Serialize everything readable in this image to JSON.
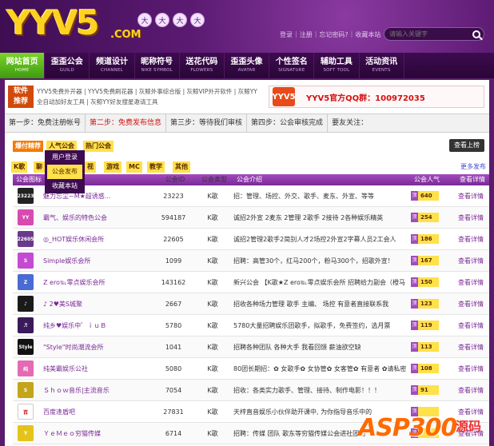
{
  "header": {
    "logo_text": "YYV5",
    "logo_suffix": ".COM",
    "lanterns": [
      "大",
      "大",
      "大",
      "大"
    ],
    "top_links": [
      "登录",
      "注册",
      "忘记密码?",
      "收藏本站"
    ],
    "search_placeholder": "请输入关键字"
  },
  "nav": [
    {
      "cn": "网站首页",
      "en": "HOME"
    },
    {
      "cn": "歪歪公会",
      "en": "GUILD"
    },
    {
      "cn": "频道设计",
      "en": "CHANNEL"
    },
    {
      "cn": "昵称符号",
      "en": "NIKE SYMBOL"
    },
    {
      "cn": "送花代码",
      "en": "FLOWERS"
    },
    {
      "cn": "歪歪头像",
      "en": "AVATAR"
    },
    {
      "cn": "个性签名",
      "en": "SIGNATURE"
    },
    {
      "cn": "辅助工具",
      "en": "SOFT TOOL"
    },
    {
      "cn": "活动资讯",
      "en": "EVENTS"
    }
  ],
  "recommend": {
    "label_line1": "软件",
    "label_line2": "推荐",
    "links_line1": [
      "YYV5免费外开器",
      "YYV5免费刷花器",
      "灰鲸外事综合版",
      "灰鲸VIP外开软件",
      "灰鲸YY"
    ],
    "links_line2": [
      "全自动加好友工具",
      "灰鲸YY好友搜星邀请工具"
    ],
    "qq_logo": "YYV5",
    "qq_text": "YYV5官方QQ群：100972035"
  },
  "steps": [
    "第一步：免费注册帐号",
    "第二步：免费发布信息",
    "第三步：等待我们审核",
    "第四步：公会审核完成",
    "要友关注："
  ],
  "tabs": {
    "tab_a": "爆付精荐",
    "tab_b": "人气公会",
    "tab_c": "热门公会",
    "view_btn": "查看上榜"
  },
  "dropdown": [
    "用户登录",
    "公会发布",
    "收藏本站"
  ],
  "categories": [
    "K歌",
    "聊",
    "视",
    "游戏",
    "MC",
    "教学",
    "其他"
  ],
  "more_link": "更多发布",
  "table": {
    "headers": [
      "公会图标",
      "公会名称",
      "公会ID",
      "公会类型",
      "公会介绍",
      "公会人气",
      "查看详情"
    ],
    "rows": [
      {
        "icon": "23223",
        "icon_color": "#222222",
        "name": "魅力忘尘~M★超诱惑...",
        "id": "23223",
        "type": "K歌",
        "desc": "招：管理、场控、外交、歌手、麦东、外宣、等等",
        "pop": "640",
        "view": "查看详情"
      },
      {
        "icon": "YY",
        "icon_color": "#d84ab0",
        "name": "霸气、娱乐的特色公会",
        "id": "594187",
        "type": "K歌",
        "desc": "诚招2外宣 2麦东 2管理 2歌手 2接待 2各种娱乐精英",
        "pop": "254",
        "view": "查看详情"
      },
      {
        "icon": "22605",
        "icon_color": "#6a3a8a",
        "name": "◎_HOT娱乐休闲会所",
        "id": "22605",
        "type": "K歌",
        "desc": "诚招2管理2歌手2简别人才2场控2外宣2字幕人员2工会人",
        "pop": "186",
        "view": "查看详情"
      },
      {
        "icon": "S",
        "icon_color": "#c44ad4",
        "name": "Simple娱乐会所",
        "id": "1099",
        "type": "K歌",
        "desc": "招聘：高管30个，红马200个，粉马300个，招歌外宣！",
        "pop": "167",
        "view": "查看详情"
      },
      {
        "icon": "Z",
        "icon_color": "#4a6ad4",
        "name": "Z ero℡零点娱乐会所",
        "id": "143162",
        "type": "K歌",
        "desc": "新兴公会 【K歌★Z ero℡零点娱乐会所 招聘给力副会（橙马",
        "pop": "150",
        "view": "查看详情"
      },
      {
        "icon": "♪",
        "icon_color": "#1a1a1a",
        "name": "♪ 2♥美S城聚",
        "id": "2667",
        "type": "K歌",
        "desc": "招收各种场力管理 歌手 主编、 场控 有意者直接联系我",
        "pop": "123",
        "view": "查看详情"
      },
      {
        "icon": "♬",
        "icon_color": "#3a1a5a",
        "name": "纯乡♥娱乐中゛ｉｕＢ",
        "id": "5780",
        "type": "K歌",
        "desc": "5780大量招聘娱乐团歌手，拟歌手，免费签约，选月票",
        "pop": "119",
        "view": "查看详情"
      },
      {
        "icon": "Style",
        "icon_color": "#111111",
        "name": "\"Style\"时尚潮流会所",
        "id": "1041",
        "type": "K歌",
        "desc": "招聘各种团队 各种大手 我看回馈 薪油欲空缺",
        "pop": "113",
        "view": "查看详情"
      },
      {
        "icon": "纯",
        "icon_color": "#e46ab4",
        "name": "纯美霸娱乐公社",
        "id": "5080",
        "type": "K歌",
        "desc": "80团长期招：✿ 女歌手✿ 女协管✿ 女客管✿ 有意者 ✿请私密",
        "pop": "108",
        "view": "查看详情"
      },
      {
        "icon": "S",
        "icon_color": "#c4a41a",
        "name": "Ｓｈｏｗ音乐|主流音乐",
        "id": "7054",
        "type": "K歌",
        "desc": "招收：各类实力歌手、管理、接待、制作电影！！！",
        "pop": "91",
        "view": "查看详情"
      },
      {
        "icon": "百",
        "icon_color": "#ffffff",
        "name": "百度逢盾吧",
        "id": "27831",
        "type": "K歌",
        "desc": "天梓直音娱乐小伙伴助开课中, 为你指导音乐中的",
        "pop": "",
        "view": "查看详情"
      },
      {
        "icon": "Y",
        "icon_color": "#e4c41a",
        "name": "ＹｅＭｅｏ穷猫传媒",
        "id": "6714",
        "type": "K歌",
        "desc": "招聘：传媒 团队 歌东等穷猫传媒公会进社团助",
        "pop": "",
        "view": "查看详情"
      }
    ]
  },
  "watermark": {
    "main": "ASP300",
    "sub": "源码"
  }
}
